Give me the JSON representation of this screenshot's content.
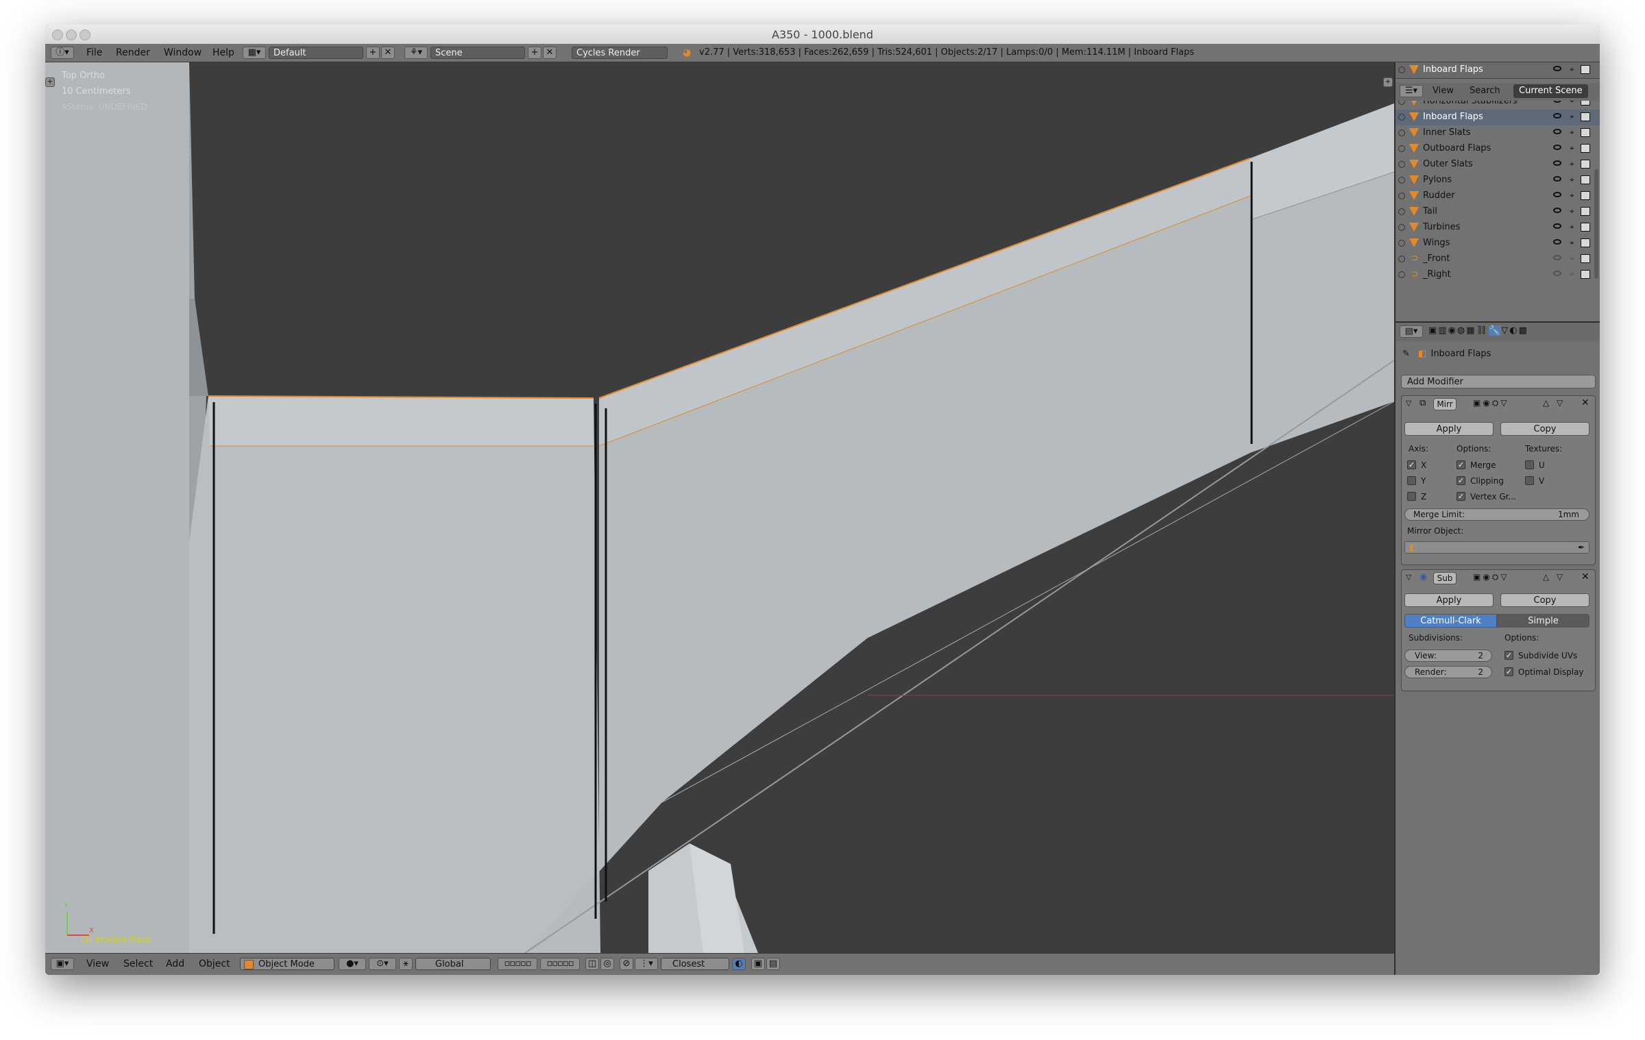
{
  "window": {
    "title": "A350 - 1000.blend"
  },
  "infobar": {
    "menus": [
      "File",
      "Render",
      "Window",
      "Help"
    ],
    "screen_layout": "Default",
    "scene": "Scene",
    "render_engine": "Cycles Render",
    "stats": "v2.77 | Verts:318,653 | Faces:262,659 | Tris:524,601 | Objects:2/17 | Lamps:0/0 | Mem:114.11M | Inboard Flaps"
  },
  "viewport": {
    "view_name": "Top Ortho",
    "scale": "10 Centimeters",
    "status": "$Status: UNDEFINED",
    "active_object": "(1) Inboard Flaps",
    "axis_y": "Y",
    "axis_x": "X"
  },
  "outliner": {
    "header_object": "Inboard Flaps",
    "tabs": [
      "View",
      "Search",
      "Current Scene"
    ],
    "items": [
      {
        "label": "Horizontal Stabilizers"
      },
      {
        "label": "Inboard Flaps"
      },
      {
        "label": "Inner Slats"
      },
      {
        "label": "Outboard Flaps"
      },
      {
        "label": "Outer Slats"
      },
      {
        "label": "Pylons"
      },
      {
        "label": "Rudder"
      },
      {
        "label": "Tail"
      },
      {
        "label": "Turbines"
      },
      {
        "label": "Wings"
      },
      {
        "label": "_Front"
      },
      {
        "label": "_Right"
      }
    ]
  },
  "properties": {
    "breadcrumb_object": "Inboard Flaps",
    "add_modifier": "Add Modifier",
    "mirror": {
      "name": "Mirr",
      "apply": "Apply",
      "copy": "Copy",
      "axis_label": "Axis:",
      "options_label": "Options:",
      "textures_label": "Textures:",
      "axis_x": "X",
      "axis_y": "Y",
      "axis_z": "Z",
      "merge": "Merge",
      "clipping": "Clipping",
      "vertex_groups": "Vertex Gr...",
      "tex_u": "U",
      "tex_v": "V",
      "merge_limit_label": "Merge Limit:",
      "merge_limit_value": "1mm",
      "mirror_object_label": "Mirror Object:"
    },
    "subsurf": {
      "name": "Sub",
      "apply": "Apply",
      "copy": "Copy",
      "catmull": "Catmull-Clark",
      "simple": "Simple",
      "subdivisions_label": "Subdivisions:",
      "options_label": "Options:",
      "view_label": "View:",
      "view_value": "2",
      "render_label": "Render:",
      "render_value": "2",
      "subdivide_uvs": "Subdivide UVs",
      "optimal_display": "Optimal Display"
    }
  },
  "header3d": {
    "menus": [
      "View",
      "Select",
      "Add",
      "Object"
    ],
    "mode": "Object Mode",
    "orientation": "Global",
    "snap": "Closest"
  }
}
